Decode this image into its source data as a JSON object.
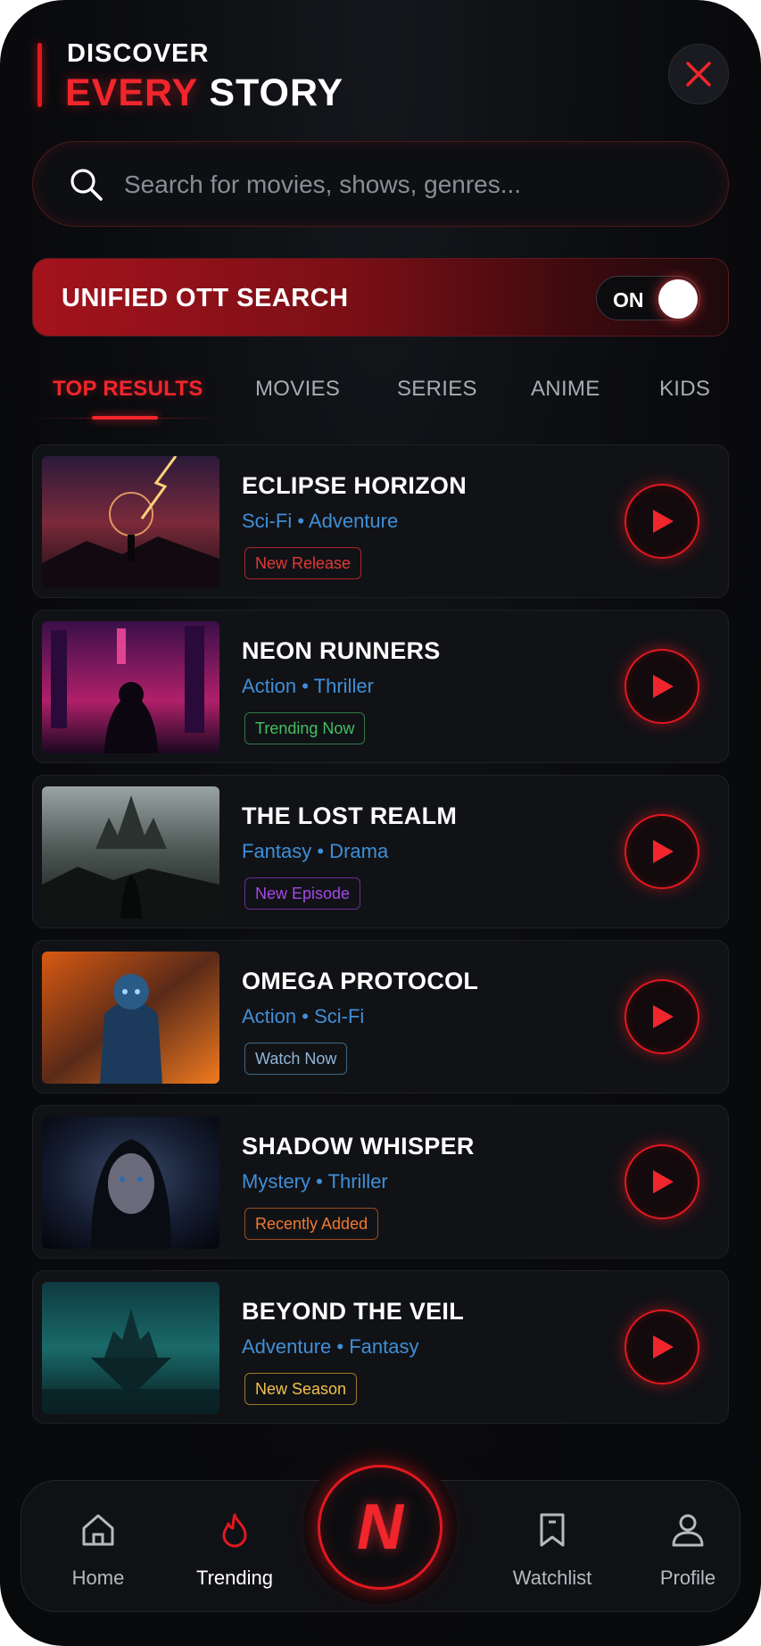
{
  "header": {
    "title_top": "DISCOVER",
    "title_red": "EVERY",
    "title_white": "STORY",
    "close_icon": "close-icon"
  },
  "search": {
    "placeholder": "Search for movies, shows, genres..."
  },
  "unified": {
    "label": "UNIFIED OTT SEARCH",
    "toggle_text": "ON"
  },
  "tabs": [
    {
      "label": "TOP RESULTS",
      "active": true
    },
    {
      "label": "MOVIES"
    },
    {
      "label": "SERIES"
    },
    {
      "label": "ANIME"
    },
    {
      "label": "KIDS"
    }
  ],
  "results": [
    {
      "title": "ECLIPSE HORIZON",
      "genres": "Sci-Fi • Adventure",
      "badge": "New Release",
      "badge_color": "#e53935"
    },
    {
      "title": "NEON RUNNERS",
      "genres": "Action • Thriller",
      "badge": "Trending Now",
      "badge_color": "#43c063"
    },
    {
      "title": "THE LOST REALM",
      "genres": "Fantasy • Drama",
      "badge": "New Episode",
      "badge_color": "#a349e6"
    },
    {
      "title": "OMEGA PROTOCOL",
      "genres": "Action • Sci-Fi",
      "badge": "Watch Now",
      "badge_color": "#8fb7d8"
    },
    {
      "title": "SHADOW WHISPER",
      "genres": "Mystery • Thriller",
      "badge": "Recently Added",
      "badge_color": "#ef7a2f"
    },
    {
      "title": "BEYOND THE VEIL",
      "genres": "Adventure • Fantasy",
      "badge": "New Season",
      "badge_color": "#f2c14a"
    }
  ],
  "nav": {
    "home": "Home",
    "trending": "Trending",
    "center_logo": "N",
    "watchlist": "Watchlist",
    "profile": "Profile"
  },
  "colors": {
    "accent": "#e1181f",
    "genre": "#3f8fd8",
    "background": "#0a0b0e"
  }
}
